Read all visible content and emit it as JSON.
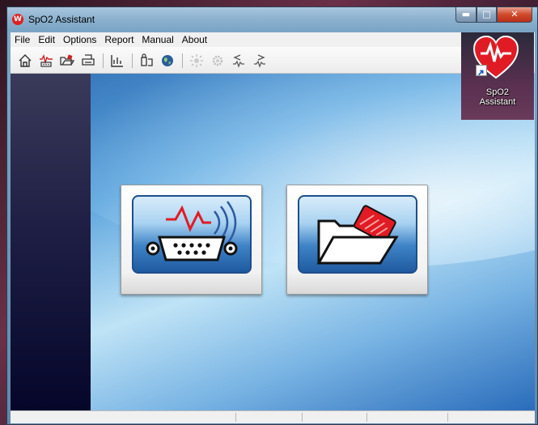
{
  "window": {
    "title": "SpO2 Assistant",
    "icon": "heart-wave-icon",
    "controls": {
      "minimize": "minimize-icon",
      "maximize": "maximize-icon",
      "close": "close-icon"
    }
  },
  "menu": [
    "File",
    "Edit",
    "Options",
    "Report",
    "Manual",
    "About"
  ],
  "toolbar": {
    "icons": [
      "home-icon",
      "monitor-icon",
      "open-folder-icon",
      "print-icon",
      "chart-icon",
      "user-settings-icon",
      "globe-icon",
      "sun-icon",
      "gear-icon",
      "wave-left-icon",
      "wave-right-icon"
    ]
  },
  "main": {
    "buttons": [
      {
        "name": "device-connect-button",
        "icon": "serial-port-signal-icon"
      },
      {
        "name": "open-file-button",
        "icon": "folder-card-icon"
      }
    ]
  },
  "desktop_shortcut": {
    "line1": "SpO2",
    "line2": "Assistant",
    "icon": "heart-pulse-icon"
  },
  "colors": {
    "accent_red": "#e11b24",
    "panel_blue": "#1d4f8c",
    "sidebar_dark": "#1f1f45"
  }
}
